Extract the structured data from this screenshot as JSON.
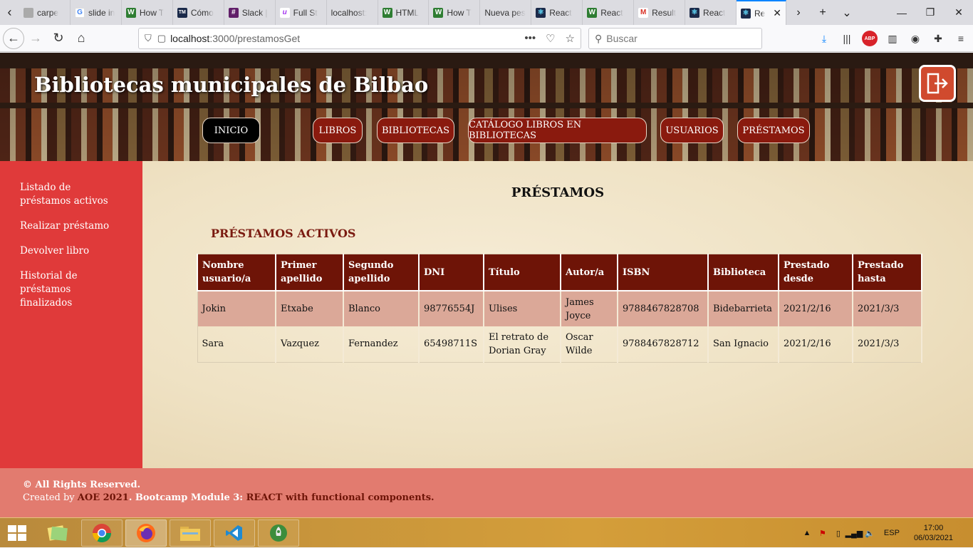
{
  "browser": {
    "tabs": [
      {
        "label": "carpe",
        "favicon": "generic-icon",
        "color": "#999999"
      },
      {
        "label": "slide in",
        "favicon": "google-icon",
        "color": "#4285f4"
      },
      {
        "label": "How T",
        "favicon": "wix-w-icon",
        "color": "#2e7d32"
      },
      {
        "label": "Cómo",
        "favicon": "tm-icon",
        "color": "#1b2a4a"
      },
      {
        "label": "Slack |",
        "favicon": "slack-icon",
        "color": "#611f69"
      },
      {
        "label": "Full St",
        "favicon": "udemy-icon",
        "color": "#a435f0"
      },
      {
        "label": "localhost:",
        "favicon": "none",
        "color": "#999999"
      },
      {
        "label": "HTML",
        "favicon": "wix-w-icon",
        "color": "#2e7d32"
      },
      {
        "label": "How T",
        "favicon": "wix-w-icon",
        "color": "#2e7d32"
      },
      {
        "label": "Nueva pes",
        "favicon": "none",
        "color": "#999999"
      },
      {
        "label": "React",
        "favicon": "react-icon",
        "color": "#1b2a4a"
      },
      {
        "label": "React",
        "favicon": "wix-w-icon",
        "color": "#2e7d32"
      },
      {
        "label": "Result",
        "favicon": "gmail-icon",
        "color": "#d93025"
      },
      {
        "label": "React",
        "favicon": "react-icon",
        "color": "#1b2a4a"
      },
      {
        "label": "Re",
        "favicon": "react-icon",
        "color": "#1b2a4a",
        "active": true
      }
    ],
    "url_host": "localhost",
    "url_path": ":3000/prestamosGet",
    "search_placeholder": "Buscar"
  },
  "site": {
    "title": "Bibliotecas municipales de Bilbao",
    "menu": [
      "INICIO",
      "LIBROS",
      "BIBLIOTECAS",
      "CATÁLOGO LIBROS EN BIBLIOTECAS",
      "USUARIOS",
      "PRÉSTAMOS"
    ]
  },
  "sidebar": {
    "items": [
      "Listado de préstamos activos",
      "Realizar préstamo",
      "Devolver libro",
      "Historial de préstamos finalizados"
    ]
  },
  "content": {
    "title": "PRÉSTAMOS",
    "section": "PRÉSTAMOS ACTIVOS",
    "columns": [
      "Nombre usuario/a",
      "Primer apellido",
      "Segundo apellido",
      "DNI",
      "Título",
      "Autor/a",
      "ISBN",
      "Biblioteca",
      "Prestado desde",
      "Prestado hasta"
    ],
    "rows": [
      [
        "Jokin",
        "Etxabe",
        "Blanco",
        "98776554J",
        "Ulises",
        "James Joyce",
        "9788467828708",
        "Bidebarrieta",
        "2021/2/16",
        "2021/3/3"
      ],
      [
        "Sara",
        "Vazquez",
        "Fernandez",
        "65498711S",
        "El retrato de Dorian Gray",
        "Oscar Wilde",
        "9788467828712",
        "San Ignacio",
        "2021/2/16",
        "2021/3/3"
      ]
    ]
  },
  "footer": {
    "line1": "© All Rights Reserved.",
    "created_by": "Created by ",
    "author": "AOE 2021",
    "bootcamp": ". Bootcamp Module 3: ",
    "topic": "REACT with functional components."
  },
  "taskbar": {
    "lang": "ESP",
    "time": "17:00",
    "date": "06/03/2021"
  },
  "colors": {
    "header_button": "#8a1a0e",
    "table_header": "#6e1407",
    "sidebar": "#e03a3a",
    "footer": "#e27b6f",
    "odd_row": "#dba898"
  }
}
